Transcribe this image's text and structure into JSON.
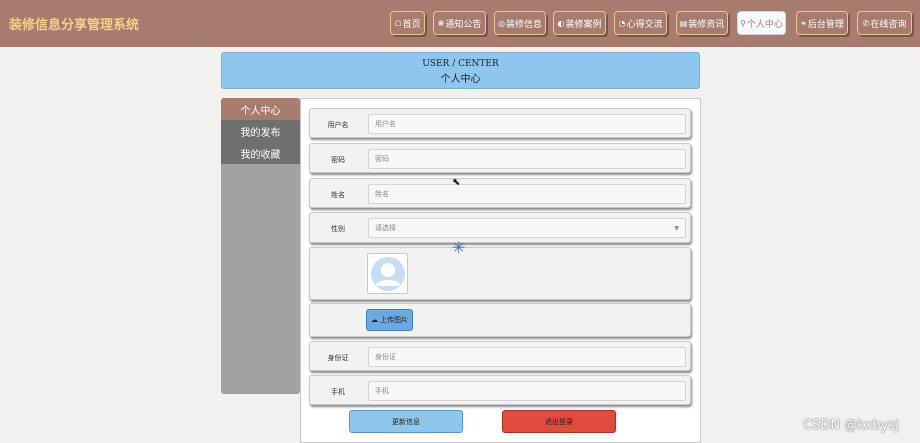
{
  "app": {
    "title": "装修信息分享管理系统"
  },
  "nav": [
    {
      "icon": "☖",
      "label": "首页"
    },
    {
      "icon": "❋",
      "label": "通知公告"
    },
    {
      "icon": "◎",
      "label": "装修信息"
    },
    {
      "icon": "◐",
      "label": "装修案例"
    },
    {
      "icon": "◔",
      "label": "心得交流"
    },
    {
      "icon": "▤",
      "label": "装修资讯"
    },
    {
      "icon": "⚲",
      "label": "个人中心"
    },
    {
      "icon": "⚭",
      "label": "后台管理"
    },
    {
      "icon": "✆",
      "label": "在线咨询"
    }
  ],
  "header": {
    "en": "USER / CENTER",
    "zh": "个人中心"
  },
  "sidebar": {
    "items": [
      {
        "label": "个人中心"
      },
      {
        "label": "我的发布"
      },
      {
        "label": "我的收藏"
      }
    ]
  },
  "form": {
    "username": {
      "label": "用户名",
      "placeholder": "用户名"
    },
    "password": {
      "label": "密码",
      "placeholder": "密码"
    },
    "name": {
      "label": "姓名",
      "placeholder": "姓名"
    },
    "gender": {
      "label": "性别",
      "value": "请选择"
    },
    "upload": {
      "label": "上传图片"
    },
    "idcard": {
      "label": "身份证",
      "placeholder": "身份证"
    },
    "phone": {
      "label": "手机",
      "placeholder": "手机"
    }
  },
  "actions": {
    "update": "更新信息",
    "logout": "退出登录"
  },
  "watermark": "CSDN @kxbysj"
}
